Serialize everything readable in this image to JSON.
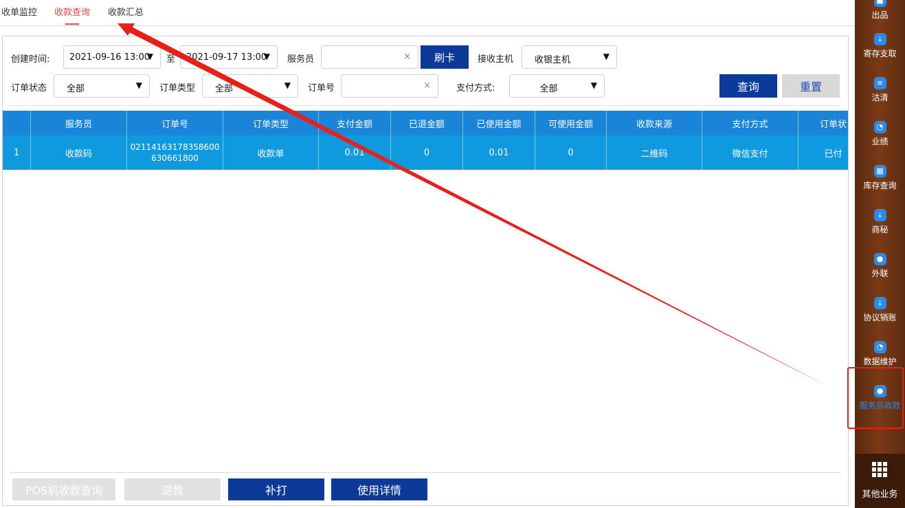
{
  "tabs": [
    {
      "label": "收单监控"
    },
    {
      "label": "收款查询"
    },
    {
      "label": "收款汇总"
    }
  ],
  "filters": {
    "created_time_label": "创建时间:",
    "start_time": "2021-09-16 13:00",
    "to_label": "至",
    "end_time": "2021-09-17 13:00",
    "waiter_label": "服务员",
    "swipe_card": "刷卡",
    "receive_host_label": "接收主机",
    "receive_host_value": "收银主机",
    "order_status_label": "订单状态",
    "order_status_value": "全部",
    "order_type_label": "订单类型",
    "order_type_value": "全部",
    "order_no_label": "订单号",
    "pay_method_label": "支付方式:",
    "pay_method_value": "全部",
    "query": "查询",
    "reset": "重置",
    "clear_glyph": "×",
    "caret_glyph": "▼"
  },
  "table": {
    "headers": [
      "",
      "服务员",
      "订单号",
      "订单类型",
      "支付金额",
      "已退金额",
      "已使用金额",
      "可使用金额",
      "收款来源",
      "支付方式",
      "订单状"
    ],
    "rows": [
      [
        "1",
        "收款码",
        "02114163178358600630661800",
        "收款单",
        "0.01",
        "0",
        "0.01",
        "0",
        "二维码",
        "微信支付",
        "已付"
      ]
    ]
  },
  "actions": {
    "pos_query": "POS机收款查询",
    "refund": "退款",
    "reprint": "补打",
    "usage_detail": "使用详情"
  },
  "sidebar": {
    "items": [
      {
        "label": "出品",
        "icon": "box-icon"
      },
      {
        "label": "寄存支取",
        "icon": "download-icon"
      },
      {
        "label": "沽清",
        "icon": "list-icon"
      },
      {
        "label": "业绩",
        "icon": "pie-icon"
      },
      {
        "label": "库存查询",
        "icon": "grid-icon"
      },
      {
        "label": "商秘",
        "icon": "download-icon"
      },
      {
        "label": "外联",
        "icon": "user-icon"
      },
      {
        "label": "协议销账",
        "icon": "download-icon"
      },
      {
        "label": "数据维护",
        "icon": "pie-icon"
      },
      {
        "label": "服务员收款",
        "icon": "person-icon"
      }
    ],
    "other_business": "其他业务"
  },
  "colors": {
    "accent_red": "#e8474a",
    "primary_blue": "#0b3a9a",
    "table_header": "#1a84d8",
    "table_row": "#0f9ae0",
    "annotation_red": "#e8201a"
  }
}
